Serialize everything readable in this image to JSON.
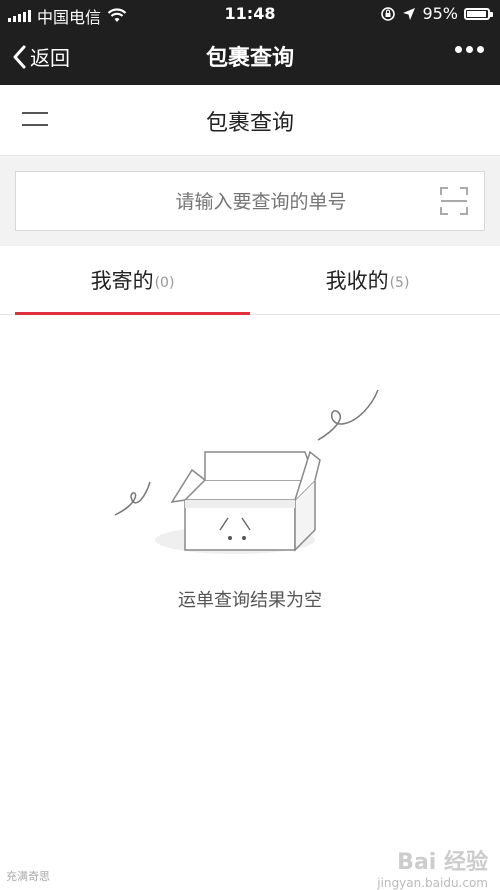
{
  "status_bar": {
    "carrier": "中国电信",
    "time": "11:48",
    "battery": "95%",
    "battery_level": 0.95
  },
  "navbar": {
    "back_label": "返回",
    "title": "包裹查询"
  },
  "page": {
    "title": "包裹查询"
  },
  "search": {
    "placeholder": "请输入要查询的单号"
  },
  "tabs": [
    {
      "label": "我寄的",
      "count": "(0)",
      "active": true
    },
    {
      "label": "我收的",
      "count": "(5)",
      "active": false
    }
  ],
  "empty_state": {
    "message": "运单查询结果为空"
  },
  "watermark": {
    "left": "充满奇思",
    "right_big": "Bai 经验",
    "right_small": "jingyan.baidu.com"
  },
  "colors": {
    "topbar": "#1f1f1f",
    "accent": "#e0303d"
  }
}
